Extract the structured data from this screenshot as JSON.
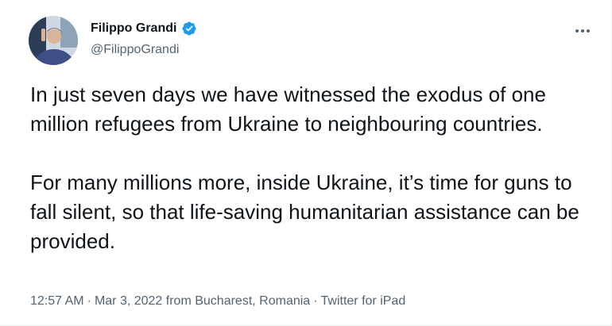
{
  "author": {
    "display_name": "Filippo Grandi",
    "handle": "@FilippoGrandi",
    "verified": true,
    "avatar_icon": "profile-photo"
  },
  "tweet": {
    "paragraphs": [
      "In just seven days we have witnessed the exodus of one million refugees from Ukraine to neighbouring countries.",
      "For many millions more, inside Ukraine, it’s time for guns to fall silent, so that life-saving humanitarian assistance can be provided."
    ]
  },
  "meta": {
    "time": "12:57 AM",
    "date": "Mar 3, 2022",
    "location": "from Bucharest, Romania",
    "source": "Twitter for iPad",
    "separator": "·"
  },
  "colors": {
    "verified_badge": "#1d9bf0",
    "secondary_text": "#536471",
    "primary_text": "#0f1419"
  },
  "icons": {
    "more": "more-horizontal-icon",
    "verified": "verified-badge-icon"
  }
}
